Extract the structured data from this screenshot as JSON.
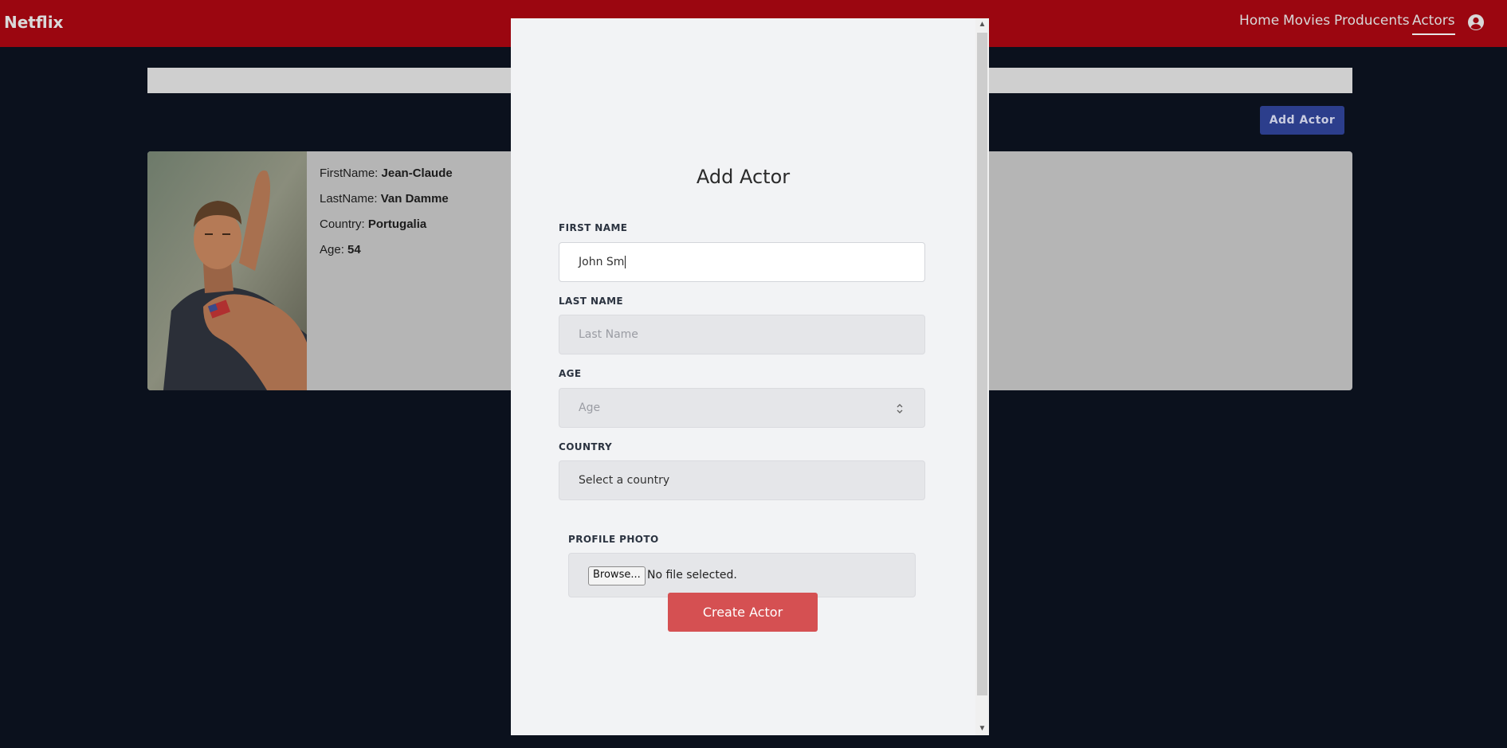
{
  "navbar": {
    "brand": "Netflix",
    "links": [
      {
        "label": "Home"
      },
      {
        "label": "Movies"
      },
      {
        "label": "Producents"
      },
      {
        "label": "Actors"
      }
    ],
    "active_link": "Actors",
    "user_icon": "account-circle-icon",
    "background_color": "#9b0610"
  },
  "toolbar": {
    "add_actor_label": "Add Actor"
  },
  "actors": [
    {
      "firstname_label": "FirstName:",
      "firstname": "Jean-Claude",
      "lastname_label": "LastName:",
      "lastname": "Van Damme",
      "country_label": "Country:",
      "country": "Portugalia",
      "age_label": "Age:",
      "age": "54"
    }
  ],
  "modal": {
    "title": "Add Actor",
    "first_name": {
      "label": "FIRST NAME",
      "value": "John Sm"
    },
    "last_name": {
      "label": "LAST NAME",
      "placeholder": "Last Name"
    },
    "age": {
      "label": "AGE",
      "placeholder": "Age"
    },
    "country": {
      "label": "COUNTRY",
      "selected": "Select a country"
    },
    "profile_photo": {
      "label": "PROFILE PHOTO",
      "browse_label": "Browse...",
      "status": "No file selected."
    },
    "submit_label": "Create Actor",
    "submit_color": "#d55052"
  }
}
